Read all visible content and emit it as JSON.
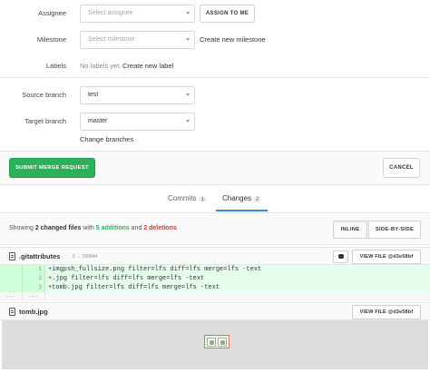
{
  "form": {
    "assignee": {
      "label": "Assignee",
      "placeholder": "Select assignee",
      "assign_to_me": "ASSIGN TO ME"
    },
    "milestone": {
      "label": "Milestone",
      "placeholder": "Select milestone",
      "create_link": "Create new milestone"
    },
    "labels": {
      "label": "Labels",
      "none_text": "No labels yet.",
      "create_link": "Create new label"
    },
    "source_branch": {
      "label": "Source branch",
      "value": "test"
    },
    "target_branch": {
      "label": "Target branch",
      "value": "master"
    },
    "change_branches": "Change branches"
  },
  "actions": {
    "submit": "SUBMIT MERGE REQUEST",
    "cancel": "CANCEL"
  },
  "tabs": [
    {
      "label": "Commits",
      "count": "1"
    },
    {
      "label": "Changes",
      "count": "2"
    }
  ],
  "summary": {
    "prefix": "Showing",
    "changed_files": "2 changed files",
    "with": "with",
    "additions": "5 additions",
    "and": "and",
    "deletions": "2 deletions"
  },
  "view_modes": {
    "inline": "INLINE",
    "side_by_side": "SIDE-BY-SIDE"
  },
  "files": [
    {
      "name": ".gitattributes",
      "mode": "0 → 100644",
      "view_file": "VIEW FILE @d3e58bf",
      "lines": [
        {
          "old": "",
          "new": "1",
          "code": "+imgpsh_fullsize.png filter=lfs diff=lfs merge=lfs -text"
        },
        {
          "old": "",
          "new": "2",
          "code": "+.jpg filter=lfs diff=lfs merge=lfs -text"
        },
        {
          "old": "",
          "new": "3",
          "code": "+tomb.jpg filter=lfs diff=lfs merge=lfs -text"
        }
      ],
      "match_left": "...",
      "match_right": "..."
    },
    {
      "name": "tomb.jpg",
      "view_file": "VIEW FILE @d3e58bf"
    }
  ],
  "colors": {
    "submit_green": "#2eb05a",
    "addition_green": "#2eb05a",
    "deletion_red": "#d9341f",
    "active_tab": "#3b87d7",
    "added_line_bg": "#e6ffed"
  }
}
